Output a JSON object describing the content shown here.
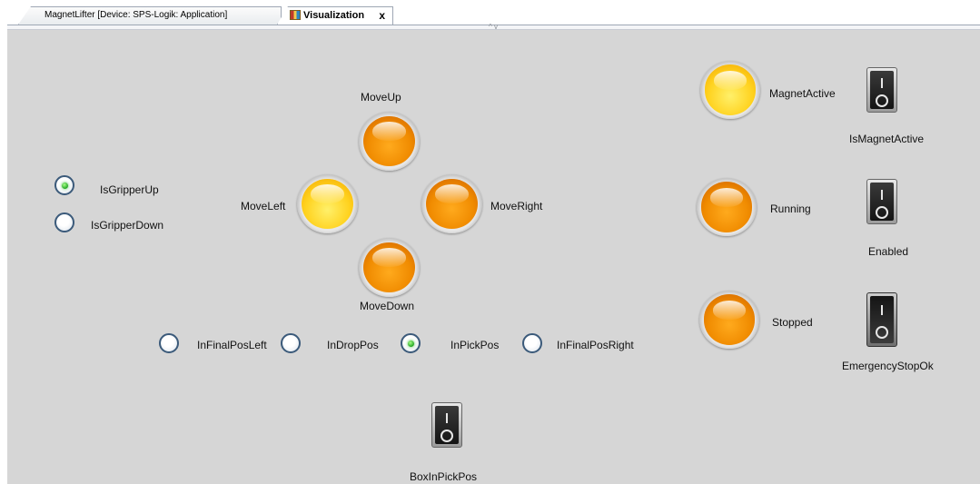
{
  "tabs": [
    {
      "label": "MagnetLifter [Device: SPS-Logik: Application]",
      "active": false
    },
    {
      "label": "Visualization",
      "active": true,
      "close": "x"
    }
  ],
  "splitter_glyph": "^ v",
  "lamps": {
    "move_up": {
      "label": "MoveUp",
      "color": "orange"
    },
    "move_left": {
      "label": "MoveLeft",
      "color": "yellow"
    },
    "move_right": {
      "label": "MoveRight",
      "color": "orange"
    },
    "move_down": {
      "label": "MoveDown",
      "color": "orange"
    },
    "magnet_active": {
      "label": "MagnetActive",
      "color": "yellow"
    },
    "running": {
      "label": "Running",
      "color": "orange"
    },
    "stopped": {
      "label": "Stopped",
      "color": "orange"
    }
  },
  "gripper_radios": [
    {
      "label": "IsGripperUp",
      "selected": true
    },
    {
      "label": "IsGripperDown",
      "selected": false
    }
  ],
  "position_radios": [
    {
      "label": "InFinalPosLeft",
      "selected": false
    },
    {
      "label": "InDropPos",
      "selected": false
    },
    {
      "label": "InPickPos",
      "selected": true
    },
    {
      "label": "InFinalPosRight",
      "selected": false
    }
  ],
  "switches": {
    "is_magnet_active": {
      "label": "IsMagnetActive",
      "state": "off"
    },
    "enabled": {
      "label": "Enabled",
      "state": "off"
    },
    "emergency_stop_ok": {
      "label": "EmergencyStopOk",
      "state": "on"
    },
    "box_in_pick_pos": {
      "label": "BoxInPickPos",
      "state": "off"
    }
  },
  "colors": {
    "canvas": "#d6d6d6",
    "lamp_orange": "#f08b00",
    "lamp_yellow": "#ffd21e",
    "radio_selected": "#22a622"
  }
}
